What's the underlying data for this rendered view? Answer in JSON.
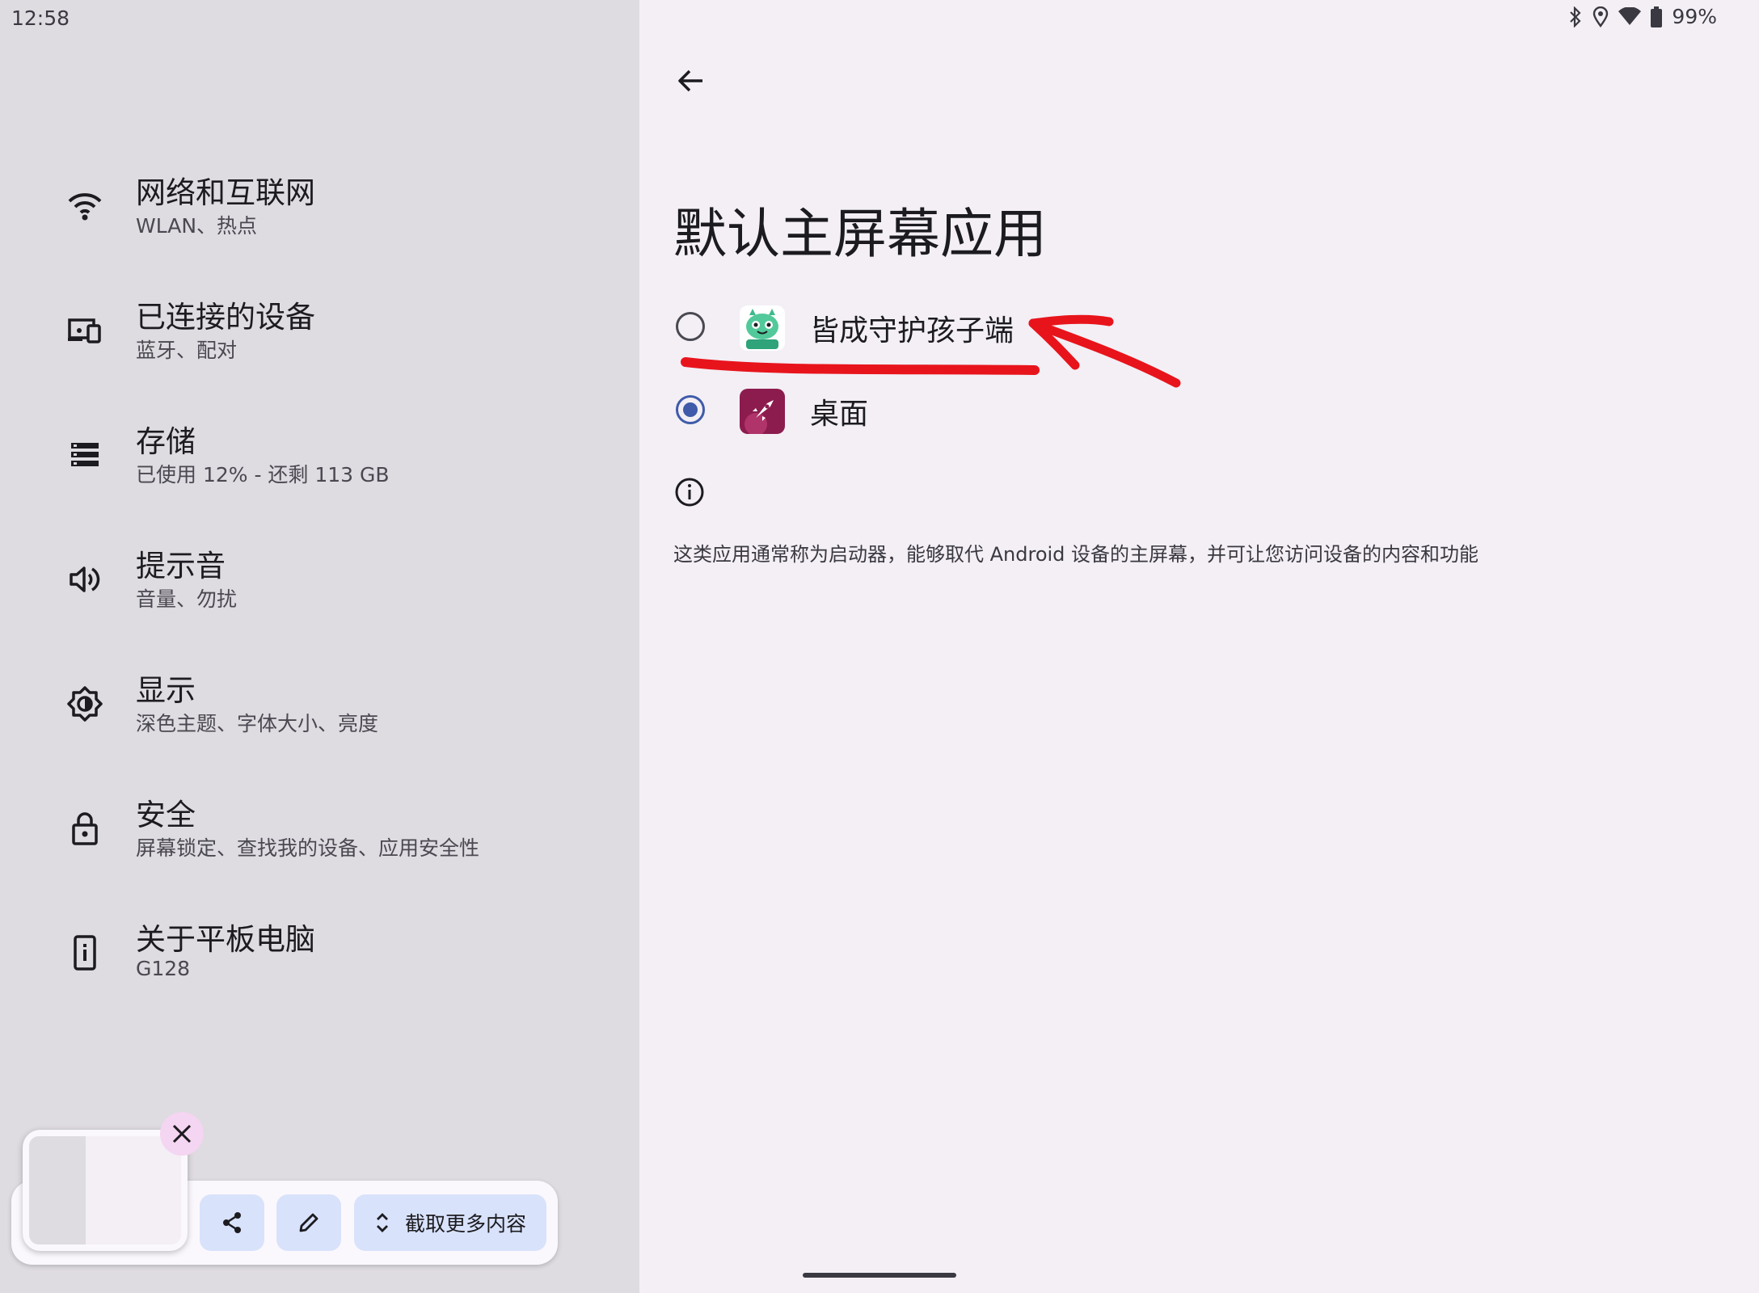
{
  "status_bar": {
    "time": "12:58",
    "battery": "99%"
  },
  "nav": [
    {
      "title": "网络和互联网",
      "subtitle": "WLAN、热点",
      "icon": "wifi-icon"
    },
    {
      "title": "已连接的设备",
      "subtitle": "蓝牙、配对",
      "icon": "connected-devices-icon"
    },
    {
      "title": "存储",
      "subtitle": "已使用 12% - 还剩 113 GB",
      "icon": "storage-icon"
    },
    {
      "title": "提示音",
      "subtitle": "音量、勿扰",
      "icon": "volume-icon"
    },
    {
      "title": "显示",
      "subtitle": "深色主题、字体大小、亮度",
      "icon": "brightness-icon"
    },
    {
      "title": "安全",
      "subtitle": "屏幕锁定、查找我的设备、应用安全性",
      "icon": "lock-icon"
    },
    {
      "title": "关于平板电脑",
      "subtitle": "G128",
      "icon": "tablet-info-icon"
    }
  ],
  "page": {
    "title": "默认主屏幕应用",
    "options": [
      {
        "label": "皆成守护孩子端",
        "checked": false,
        "icon": "guardian-app-icon"
      },
      {
        "label": "桌面",
        "checked": true,
        "icon": "launcher-rocket-icon"
      }
    ],
    "info_text": "这类应用通常称为启动器，能够取代 Android 设备的主屏幕，并可让您访问设备的内容和功能"
  },
  "screenshot_toolbar": {
    "more_label": "截取更多内容"
  },
  "colors": {
    "accent": "#3f5ba9",
    "left_bg": "#dedbe1",
    "right_bg": "#f3eff5",
    "annotation": "#e8141c"
  }
}
